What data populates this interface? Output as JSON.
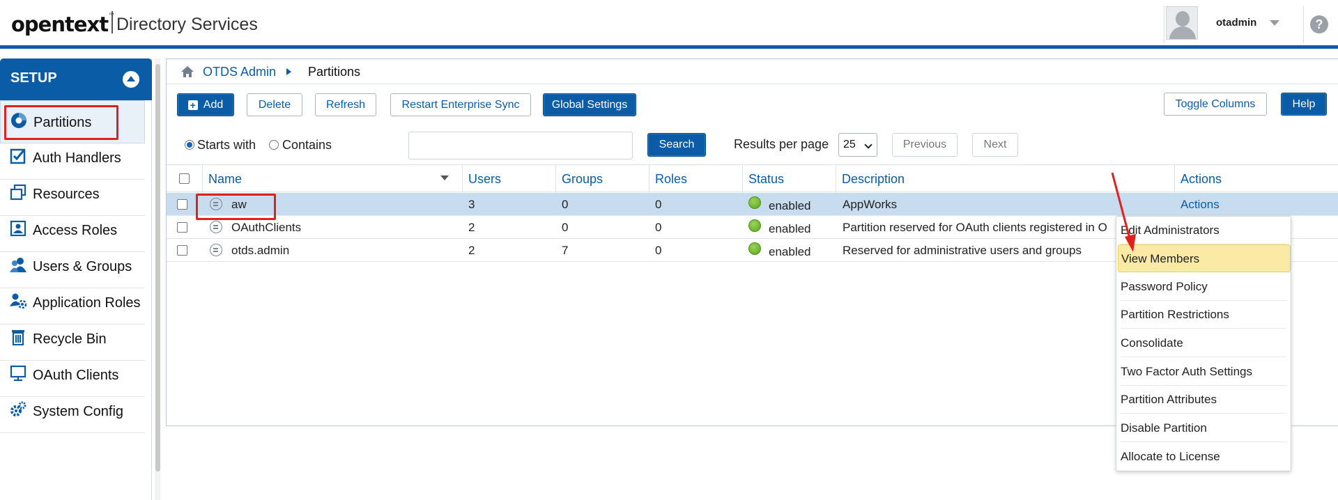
{
  "header": {
    "logo_text": "opentext",
    "logo_tm": "™",
    "app_name": "Directory Services",
    "username": "otadmin",
    "help_glyph": "?"
  },
  "sidebar": {
    "section_title": "SETUP",
    "items": [
      {
        "label": "Partitions",
        "icon": "partitions-icon"
      },
      {
        "label": "Auth Handlers",
        "icon": "checkbox-icon"
      },
      {
        "label": "Resources",
        "icon": "resources-icon"
      },
      {
        "label": "Access Roles",
        "icon": "access-roles-icon"
      },
      {
        "label": "Users & Groups",
        "icon": "users-icon"
      },
      {
        "label": "Application Roles",
        "icon": "app-roles-icon"
      },
      {
        "label": "Recycle Bin",
        "icon": "trash-icon"
      },
      {
        "label": "OAuth Clients",
        "icon": "monitor-icon"
      },
      {
        "label": "System Config",
        "icon": "gears-icon"
      }
    ]
  },
  "breadcrumb": {
    "root": "OTDS Admin",
    "current": "Partitions"
  },
  "toolbar": {
    "add": "Add",
    "delete": "Delete",
    "refresh": "Refresh",
    "restart_sync": "Restart Enterprise Sync",
    "global_settings": "Global Settings",
    "toggle_columns": "Toggle Columns",
    "help": "Help"
  },
  "search": {
    "starts_with": "Starts with",
    "contains": "Contains",
    "value": "",
    "button": "Search",
    "results_per_page_label": "Results per page",
    "results_per_page": "25",
    "previous": "Previous",
    "next": "Next"
  },
  "table": {
    "columns": [
      "Name",
      "Users",
      "Groups",
      "Roles",
      "Status",
      "Description",
      "Actions"
    ],
    "rows": [
      {
        "name": "aw",
        "users": "3",
        "groups": "0",
        "roles": "0",
        "status": "enabled",
        "description": "AppWorks",
        "actions": "Actions"
      },
      {
        "name": "OAuthClients",
        "users": "2",
        "groups": "0",
        "roles": "0",
        "status": "enabled",
        "description": "Partition reserved for OAuth clients registered in O",
        "actions": ""
      },
      {
        "name": "otds.admin",
        "users": "2",
        "groups": "7",
        "roles": "0",
        "status": "enabled",
        "description": "Reserved for administrative users and groups",
        "actions": ""
      }
    ]
  },
  "actions_menu": {
    "items": [
      "Edit Administrators",
      "View Members",
      "Password Policy",
      "Partition Restrictions",
      "Consolidate",
      "Two Factor Auth Settings",
      "Partition Attributes",
      "Disable Partition",
      "Allocate to License"
    ],
    "highlighted": "View Members"
  },
  "colors": {
    "brand_blue": "#0a5ca6",
    "highlight_red": "#e0201c",
    "status_green": "#5aa520",
    "menu_highlight": "#fbeaa6"
  }
}
